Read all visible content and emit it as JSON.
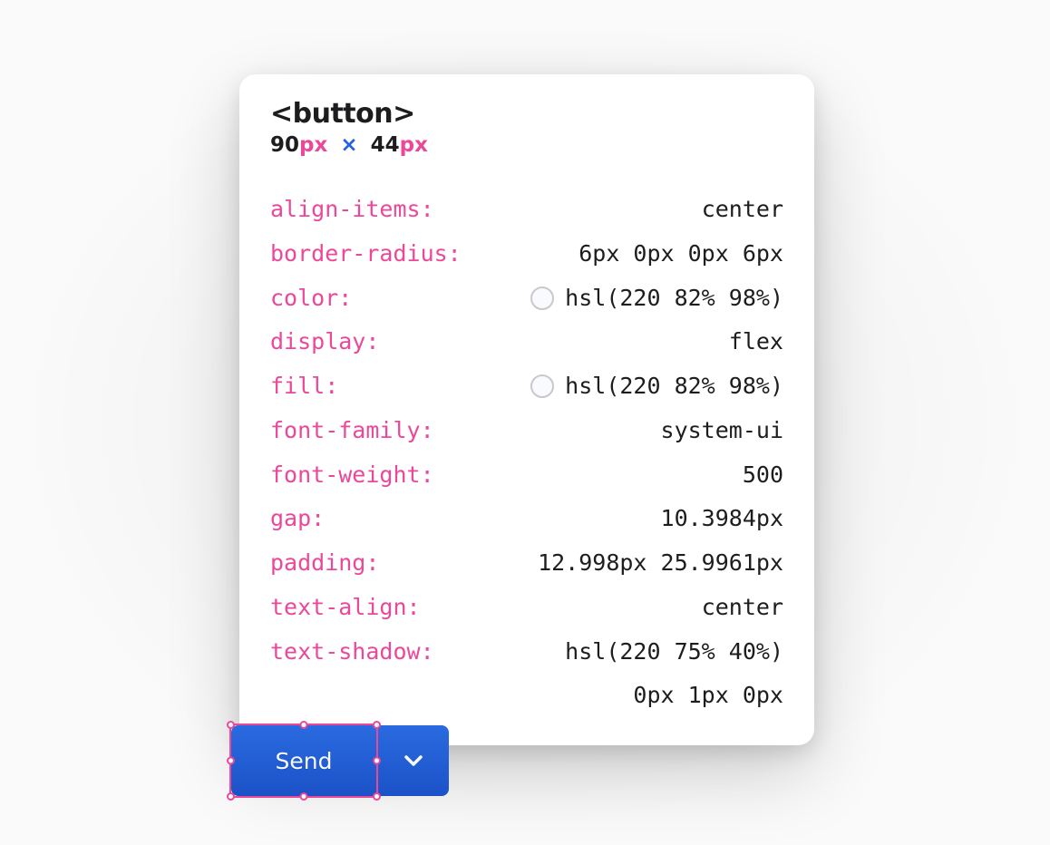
{
  "inspector": {
    "tag": "<button>",
    "dimensions": {
      "width": "90",
      "height": "44",
      "unit": "px"
    },
    "properties": [
      {
        "key": "align-items",
        "value": "center"
      },
      {
        "key": "border-radius",
        "value": "6px 0px 0px 6px"
      },
      {
        "key": "color",
        "value": "hsl(220 82% 98%)",
        "swatch": true
      },
      {
        "key": "display",
        "value": "flex"
      },
      {
        "key": "fill",
        "value": "hsl(220 82% 98%)",
        "swatch": true
      },
      {
        "key": "font-family",
        "value": "system-ui"
      },
      {
        "key": "font-weight",
        "value": "500"
      },
      {
        "key": "gap",
        "value": "10.3984px"
      },
      {
        "key": "padding",
        "value": "12.998px 25.9961px"
      },
      {
        "key": "text-align",
        "value": "center"
      },
      {
        "key": "text-shadow",
        "value": "hsl(220 75% 40%)",
        "value2": "0px 1px 0px"
      }
    ]
  },
  "button": {
    "label": "Send",
    "icons": {
      "dropdown": "chevron-down-icon"
    }
  }
}
